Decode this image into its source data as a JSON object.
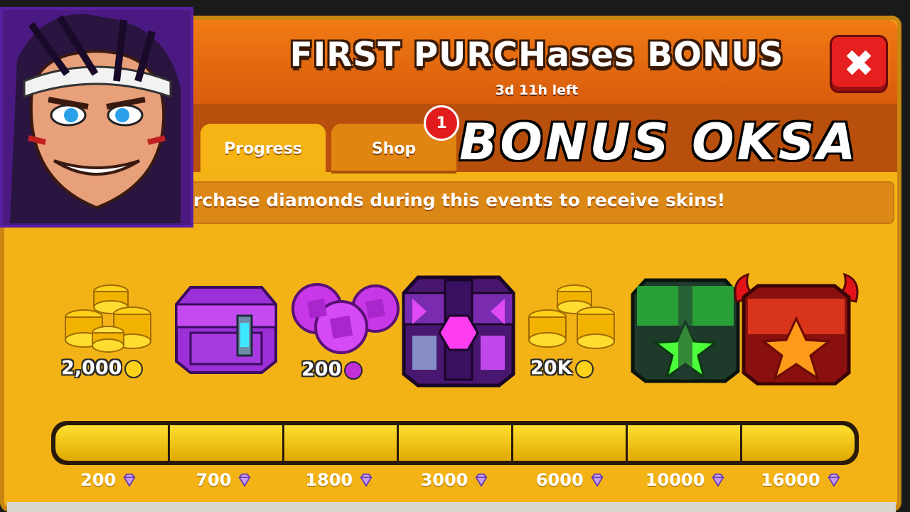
{
  "header": {
    "title": "FIRST PURCHases BONUS",
    "timer": "3d 11h left",
    "close_label": "✖"
  },
  "tabs": [
    {
      "label": "Progress",
      "active": true
    },
    {
      "label": "Shop",
      "active": false,
      "badge": "1"
    }
  ],
  "watermark": "BONUS OKSA",
  "info": "rchase diamonds during this events to receive skins!",
  "rewards": [
    {
      "type": "coins",
      "label": "2,000",
      "icon": "coin-icon"
    },
    {
      "type": "chest",
      "icon": "purple-chest-icon"
    },
    {
      "type": "gems",
      "label": "200",
      "icon": "gem-icon"
    },
    {
      "type": "chest",
      "icon": "dark-purple-chest-icon"
    },
    {
      "type": "coins",
      "label": "20K",
      "icon": "coin-icon"
    },
    {
      "type": "chest",
      "icon": "green-chest-icon"
    },
    {
      "type": "chest",
      "icon": "red-demon-chest-icon"
    }
  ],
  "milestones": [
    "200",
    "700",
    "1800",
    "3000",
    "6000",
    "10000",
    "16000"
  ],
  "colors": {
    "panel": "#f3b316",
    "header": "#e56a10",
    "close": "#e5201f",
    "bar_fill": "#ffd321",
    "diamond": "#c69cf0"
  }
}
